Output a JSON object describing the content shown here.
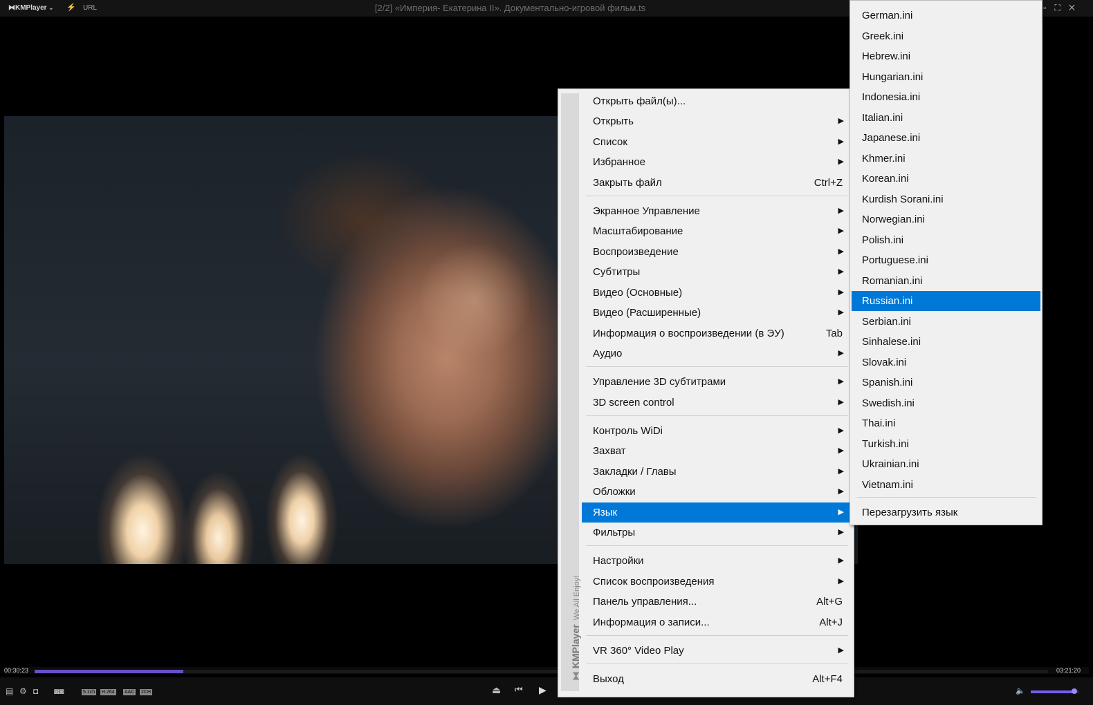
{
  "app": {
    "brand": "KMPlayer",
    "url_label": "URL"
  },
  "window": {
    "title": "[2/2] «Империя- Екатерина II». Документально-игровой фильм.ts"
  },
  "playback": {
    "elapsed": "00:30:23",
    "duration": "03:21:20",
    "progress": 0.147,
    "volume": 0.9
  },
  "codec_badges": [
    "5.1ch",
    "H.264",
    "AAC",
    "2CH"
  ],
  "main_menu": {
    "side_brand": "KMPlayer",
    "side_slogan": "We All Enjoy!",
    "items": [
      {
        "label": "Открыть файл(ы)...",
        "shortcut": "",
        "submenu": false,
        "highlighted": false
      },
      {
        "label": "Открыть",
        "shortcut": "",
        "submenu": true,
        "highlighted": false
      },
      {
        "label": "Список",
        "shortcut": "",
        "submenu": true,
        "highlighted": false
      },
      {
        "label": "Избранное",
        "shortcut": "",
        "submenu": true,
        "highlighted": false
      },
      {
        "label": "Закрыть файл",
        "shortcut": "Ctrl+Z",
        "submenu": false,
        "highlighted": false
      },
      {
        "label": "Экранное Управление",
        "shortcut": "",
        "submenu": true,
        "highlighted": false
      },
      {
        "label": "Масштабирование",
        "shortcut": "",
        "submenu": true,
        "highlighted": false
      },
      {
        "label": "Воспроизведение",
        "shortcut": "",
        "submenu": true,
        "highlighted": false
      },
      {
        "label": "Субтитры",
        "shortcut": "",
        "submenu": true,
        "highlighted": false
      },
      {
        "label": "Видео (Основные)",
        "shortcut": "",
        "submenu": true,
        "highlighted": false
      },
      {
        "label": "Видео (Расширенные)",
        "shortcut": "",
        "submenu": true,
        "highlighted": false
      },
      {
        "label": "Информация о воспроизведении (в ЭУ)",
        "shortcut": "Tab",
        "submenu": false,
        "highlighted": false
      },
      {
        "label": "Аудио",
        "shortcut": "",
        "submenu": true,
        "highlighted": false
      },
      {
        "label": "Управление 3D субтитрами",
        "shortcut": "",
        "submenu": true,
        "highlighted": false
      },
      {
        "label": "3D screen control",
        "shortcut": "",
        "submenu": true,
        "highlighted": false
      },
      {
        "label": "Контроль WiDi",
        "shortcut": "",
        "submenu": true,
        "highlighted": false
      },
      {
        "label": "Захват",
        "shortcut": "",
        "submenu": true,
        "highlighted": false
      },
      {
        "label": "Закладки / Главы",
        "shortcut": "",
        "submenu": true,
        "highlighted": false
      },
      {
        "label": "Обложки",
        "shortcut": "",
        "submenu": true,
        "highlighted": false
      },
      {
        "label": "Язык",
        "shortcut": "",
        "submenu": true,
        "highlighted": true
      },
      {
        "label": "Фильтры",
        "shortcut": "",
        "submenu": true,
        "highlighted": false
      },
      {
        "label": "Настройки",
        "shortcut": "",
        "submenu": true,
        "highlighted": false
      },
      {
        "label": "Список воспроизведения",
        "shortcut": "",
        "submenu": true,
        "highlighted": false
      },
      {
        "label": "Панель управления...",
        "shortcut": "Alt+G",
        "submenu": false,
        "highlighted": false
      },
      {
        "label": "Информация о записи...",
        "shortcut": "Alt+J",
        "submenu": false,
        "highlighted": false
      },
      {
        "label": "VR 360° Video Play",
        "shortcut": "",
        "submenu": true,
        "highlighted": false
      },
      {
        "label": "Выход",
        "shortcut": "Alt+F4",
        "submenu": false,
        "highlighted": false
      }
    ]
  },
  "language_menu": {
    "items": [
      {
        "label": "German.ini",
        "highlighted": false
      },
      {
        "label": "Greek.ini",
        "highlighted": false
      },
      {
        "label": "Hebrew.ini",
        "highlighted": false
      },
      {
        "label": "Hungarian.ini",
        "highlighted": false
      },
      {
        "label": "Indonesia.ini",
        "highlighted": false
      },
      {
        "label": "Italian.ini",
        "highlighted": false
      },
      {
        "label": "Japanese.ini",
        "highlighted": false
      },
      {
        "label": "Khmer.ini",
        "highlighted": false
      },
      {
        "label": "Korean.ini",
        "highlighted": false
      },
      {
        "label": "Kurdish Sorani.ini",
        "highlighted": false
      },
      {
        "label": "Norwegian.ini",
        "highlighted": false
      },
      {
        "label": "Polish.ini",
        "highlighted": false
      },
      {
        "label": "Portuguese.ini",
        "highlighted": false
      },
      {
        "label": "Romanian.ini",
        "highlighted": false
      },
      {
        "label": "Russian.ini",
        "highlighted": true
      },
      {
        "label": "Serbian.ini",
        "highlighted": false
      },
      {
        "label": "Sinhalese.ini",
        "highlighted": false
      },
      {
        "label": "Slovak.ini",
        "highlighted": false
      },
      {
        "label": "Spanish.ini",
        "highlighted": false
      },
      {
        "label": "Swedish.ini",
        "highlighted": false
      },
      {
        "label": "Thai.ini",
        "highlighted": false
      },
      {
        "label": "Turkish.ini",
        "highlighted": false
      },
      {
        "label": "Ukrainian.ini",
        "highlighted": false
      },
      {
        "label": "Vietnam.ini",
        "highlighted": false
      }
    ],
    "reload_label": "Перезагрузить язык"
  },
  "colors": {
    "highlight": "#0078d7",
    "seek_fill": "#6a4fc8",
    "volume_fill": "#7a5cf0"
  },
  "icons": [
    "lightning-icon",
    "restore-icon",
    "fullscreen-icon",
    "close-icon",
    "playlist-icon",
    "settings-icon",
    "3d-icon",
    "vr-icon",
    "eject-icon",
    "previous-icon",
    "play-icon",
    "volume-icon",
    "submenu-arrow-icon"
  ]
}
